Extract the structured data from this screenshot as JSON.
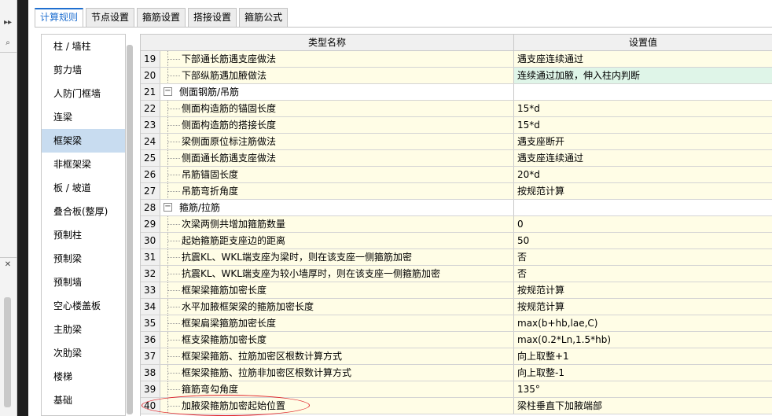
{
  "tabs": [
    {
      "label": "计算规则",
      "active": true
    },
    {
      "label": "节点设置",
      "active": false
    },
    {
      "label": "箍筋设置",
      "active": false
    },
    {
      "label": "搭接设置",
      "active": false
    },
    {
      "label": "箍筋公式",
      "active": false
    }
  ],
  "categories": [
    {
      "label": "柱 / 墙柱"
    },
    {
      "label": "剪力墙"
    },
    {
      "label": "人防门框墙"
    },
    {
      "label": "连梁"
    },
    {
      "label": "框架梁",
      "active": true
    },
    {
      "label": "非框架梁"
    },
    {
      "label": "板 / 坡道"
    },
    {
      "label": "叠合板(整厚)"
    },
    {
      "label": "预制柱"
    },
    {
      "label": "预制梁"
    },
    {
      "label": "预制墙"
    },
    {
      "label": "空心楼盖板"
    },
    {
      "label": "主肋梁"
    },
    {
      "label": "次肋梁"
    },
    {
      "label": "楼梯"
    },
    {
      "label": "基础"
    }
  ],
  "grid": {
    "header_name": "类型名称",
    "header_value": "设置值",
    "rows": [
      {
        "num": "19",
        "name": "下部通长筋遇支座做法",
        "value": "遇支座连续通过"
      },
      {
        "num": "20",
        "name": "下部纵筋遇加腋做法",
        "value": "连续通过加腋，伸入柱内判断",
        "highlight": true
      },
      {
        "num": "21",
        "name": "侧面钢筋/吊筋",
        "value": "",
        "group": true,
        "expander": "−"
      },
      {
        "num": "22",
        "name": "侧面构造筋的锚固长度",
        "value": "15*d"
      },
      {
        "num": "23",
        "name": "侧面构造筋的搭接长度",
        "value": "15*d"
      },
      {
        "num": "24",
        "name": "梁侧面原位标注筋做法",
        "value": "遇支座断开"
      },
      {
        "num": "25",
        "name": "侧面通长筋遇支座做法",
        "value": "遇支座连续通过"
      },
      {
        "num": "26",
        "name": "吊筋锚固长度",
        "value": "20*d"
      },
      {
        "num": "27",
        "name": "吊筋弯折角度",
        "value": "按规范计算"
      },
      {
        "num": "28",
        "name": "箍筋/拉筋",
        "value": "",
        "group": true,
        "expander": "−"
      },
      {
        "num": "29",
        "name": "次梁两侧共增加箍筋数量",
        "value": "0"
      },
      {
        "num": "30",
        "name": "起始箍筋距支座边的距离",
        "value": "50"
      },
      {
        "num": "31",
        "name": "抗震KL、WKL端支座为梁时，则在该支座一侧箍筋加密",
        "value": "否"
      },
      {
        "num": "32",
        "name": "抗震KL、WKL端支座为较小墙厚时，则在该支座一侧箍筋加密",
        "value": "否"
      },
      {
        "num": "33",
        "name": "框架梁箍筋加密长度",
        "value": "按规范计算"
      },
      {
        "num": "34",
        "name": "水平加腋框架梁的箍筋加密长度",
        "value": "按规范计算"
      },
      {
        "num": "35",
        "name": "框架扁梁箍筋加密长度",
        "value": "max(b+hb,lae,C)"
      },
      {
        "num": "36",
        "name": "框支梁箍筋加密长度",
        "value": "max(0.2*Ln,1.5*hb)"
      },
      {
        "num": "37",
        "name": "框架梁箍筋、拉筋加密区根数计算方式",
        "value": "向上取整+1"
      },
      {
        "num": "38",
        "name": "框架梁箍筋、拉筋非加密区根数计算方式",
        "value": "向上取整-1"
      },
      {
        "num": "39",
        "name": "箍筋弯勾角度",
        "value": "135°"
      },
      {
        "num": "40",
        "name": "加腋梁箍筋加密起始位置",
        "value": "梁柱垂直下加腋端部"
      }
    ]
  },
  "left_rail": {
    "expand_glyph": "▸▸",
    "search_glyph": "⌕",
    "close_glyph": "✕"
  },
  "colors": {
    "accent": "#1f6fd0",
    "name_cell_bg": "#fffde6",
    "highlight_bg": "#dff5e8",
    "selected_category": "#c8dcf0",
    "annotation": "#e0242a"
  }
}
